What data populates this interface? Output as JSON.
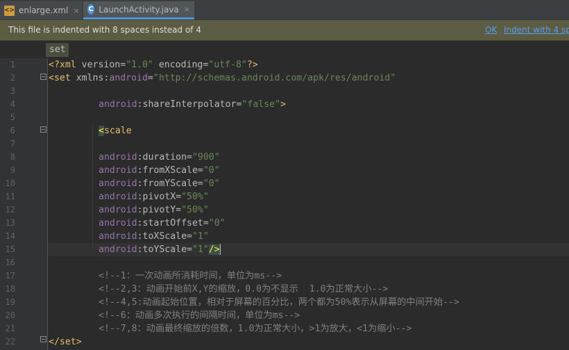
{
  "tabs": [
    {
      "label": "enlarge.xml",
      "close": "×"
    },
    {
      "label": "LaunchActivity.java",
      "close": "×"
    }
  ],
  "notice": {
    "message": "This file is indented with 8 spaces instead of 4",
    "ok": "OK",
    "indent_link": "Indent with 4 sp"
  },
  "breadcrumb": "set",
  "line_numbers": [
    "1",
    "2",
    "3",
    "4",
    "5",
    "6",
    "7",
    "8",
    "9",
    "10",
    "11",
    "12",
    "13",
    "14",
    "15",
    "16",
    "17",
    "18",
    "19",
    "20",
    "21",
    "22"
  ],
  "code": {
    "l1": {
      "open": "<?xml ",
      "version_attr": "version=",
      "version_val": "\"1.0\"",
      "encoding_attr": " encoding=",
      "encoding_val": "\"utf-8\"",
      "close": "?>"
    },
    "l2": {
      "tag": "<set ",
      "attr": "xmlns:",
      "ns": "android",
      "eq": "=",
      "val": "\"http://schemas.android.com/apk/res/android\""
    },
    "l4": {
      "ns": "android",
      "attr": ":shareInterpolator=",
      "val": "\"false\"",
      "close": ">"
    },
    "l6": {
      "bracket": "<",
      "tag": "scale"
    },
    "attrs": [
      {
        "ns": "android",
        "attr": ":duration=",
        "val": "\"900\""
      },
      {
        "ns": "android",
        "attr": ":fromXScale=",
        "val": "\"0\""
      },
      {
        "ns": "android",
        "attr": ":fromYScale=",
        "val": "\"0\""
      },
      {
        "ns": "android",
        "attr": ":pivotX=",
        "val": "\"50%\""
      },
      {
        "ns": "android",
        "attr": ":pivotY=",
        "val": "\"50%\""
      },
      {
        "ns": "android",
        "attr": ":startOffset=",
        "val": "\"0\""
      },
      {
        "ns": "android",
        "attr": ":toXScale=",
        "val": "\"1\""
      },
      {
        "ns": "android",
        "attr": ":toYScale=",
        "val": "\"1\"",
        "close": "/>"
      }
    ],
    "comments": [
      "<!--1：一次动画所消耗时间，单位为ms-->",
      "<!--2,3：动画开始前X,Y的缩放，0.0为不显示  1.0为正常大小-->",
      "<!--4,5:动画起始位置，相对于屏幕的百分比，两个都为50%表示从屏幕的中间开始-->",
      "<!--6：动画多次执行的间隔时间，单位为ms-->",
      "<!--7,8：动画最终缩放的倍数，1.0为正常大小，>1为放大，<1为缩小-->"
    ],
    "l22": "</set>"
  }
}
